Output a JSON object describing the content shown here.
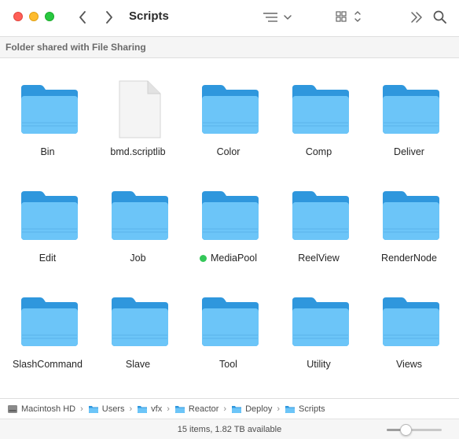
{
  "window": {
    "title": "Scripts",
    "subheader": "Folder shared with File Sharing"
  },
  "toolbar": {
    "icons": [
      "close-button",
      "minimize-button",
      "zoom-button",
      "back-icon",
      "forward-icon",
      "list-view-icon",
      "grid-view-icon",
      "more-icon",
      "search-icon"
    ]
  },
  "items": [
    {
      "name": "Bin",
      "kind": "folder"
    },
    {
      "name": "bmd.scriptlib",
      "kind": "file"
    },
    {
      "name": "Color",
      "kind": "folder"
    },
    {
      "name": "Comp",
      "kind": "folder"
    },
    {
      "name": "Deliver",
      "kind": "folder"
    },
    {
      "name": "Edit",
      "kind": "folder"
    },
    {
      "name": "Job",
      "kind": "folder"
    },
    {
      "name": "MediaPool",
      "kind": "folder",
      "tag_color": "#34c759"
    },
    {
      "name": "ReelView",
      "kind": "folder"
    },
    {
      "name": "RenderNode",
      "kind": "folder"
    },
    {
      "name": "SlashCommand",
      "kind": "folder"
    },
    {
      "name": "Slave",
      "kind": "folder"
    },
    {
      "name": "Tool",
      "kind": "folder"
    },
    {
      "name": "Utility",
      "kind": "folder"
    },
    {
      "name": "Views",
      "kind": "folder"
    }
  ],
  "pathbar": [
    {
      "label": "Macintosh HD",
      "icon": "disk-icon"
    },
    {
      "label": "Users",
      "icon": "folder-icon"
    },
    {
      "label": "vfx",
      "icon": "folder-icon"
    },
    {
      "label": "Reactor",
      "icon": "folder-icon"
    },
    {
      "label": "Deploy",
      "icon": "folder-icon"
    },
    {
      "label": "Scripts",
      "icon": "folder-icon"
    }
  ],
  "status": {
    "text": "15 items, 1.82 TB available",
    "icon_size_fraction": 0.35
  },
  "colors": {
    "folder_back": "#2f97dd",
    "folder_front": "#6cc5f8",
    "folder_stripe": "#5ab4ea",
    "tag_green": "#34c759"
  }
}
